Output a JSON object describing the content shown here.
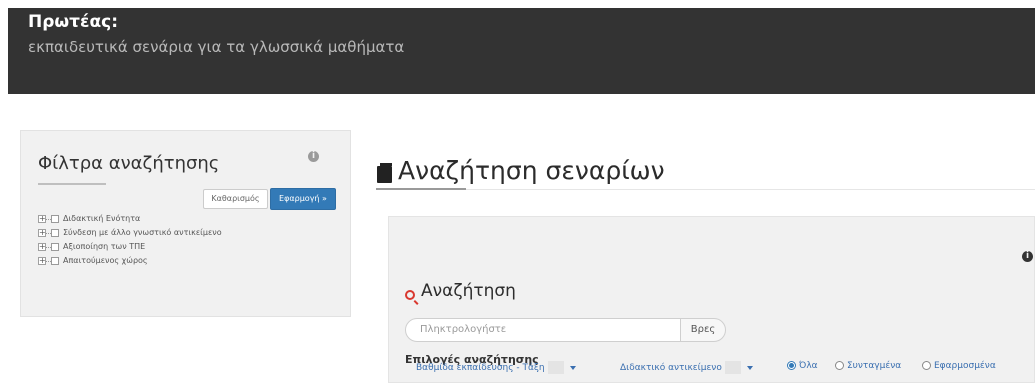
{
  "header": {
    "title": "Πρωτέας:",
    "subtitle": "εκπαιδευτικά σενάρια για τα γλωσσικά μαθήματα"
  },
  "filters": {
    "title": "Φίλτρα αναζήτησης",
    "info_icon": "i",
    "clear_label": "Καθαρισμός",
    "apply_label": "Εφαρμογή »",
    "tree_items": [
      {
        "label": "Διδακτική Ενότητα"
      },
      {
        "label": "Σύνδεση με άλλο γνωστικό αντικείμενο"
      },
      {
        "label": "Αξιοποίηση των ΤΠΕ"
      },
      {
        "label": "Απαιτούμενος χώρος"
      }
    ]
  },
  "main": {
    "title": "Αναζήτηση σεναρίων",
    "search": {
      "heading": "Αναζήτηση",
      "placeholder": "Πληκτρολογήστε",
      "button_label": "Βρες",
      "info_icon": "i",
      "options_title": "Επιλογές αναζήτησης",
      "selects": [
        {
          "label": "Βαθμίδα εκπαίδευσης - Τάξη"
        },
        {
          "label": "Διδακτικό αντικείμενο"
        }
      ],
      "radios": [
        {
          "label": "Όλα",
          "checked": true
        },
        {
          "label": "Συνταγμένα",
          "checked": false
        },
        {
          "label": "Εφαρμοσμένα",
          "checked": false
        }
      ]
    }
  },
  "colors": {
    "header_bg": "#333333",
    "accent_blue": "#337ab7",
    "search_icon": "#d9382f",
    "panel_bg": "#f1f1f1"
  }
}
